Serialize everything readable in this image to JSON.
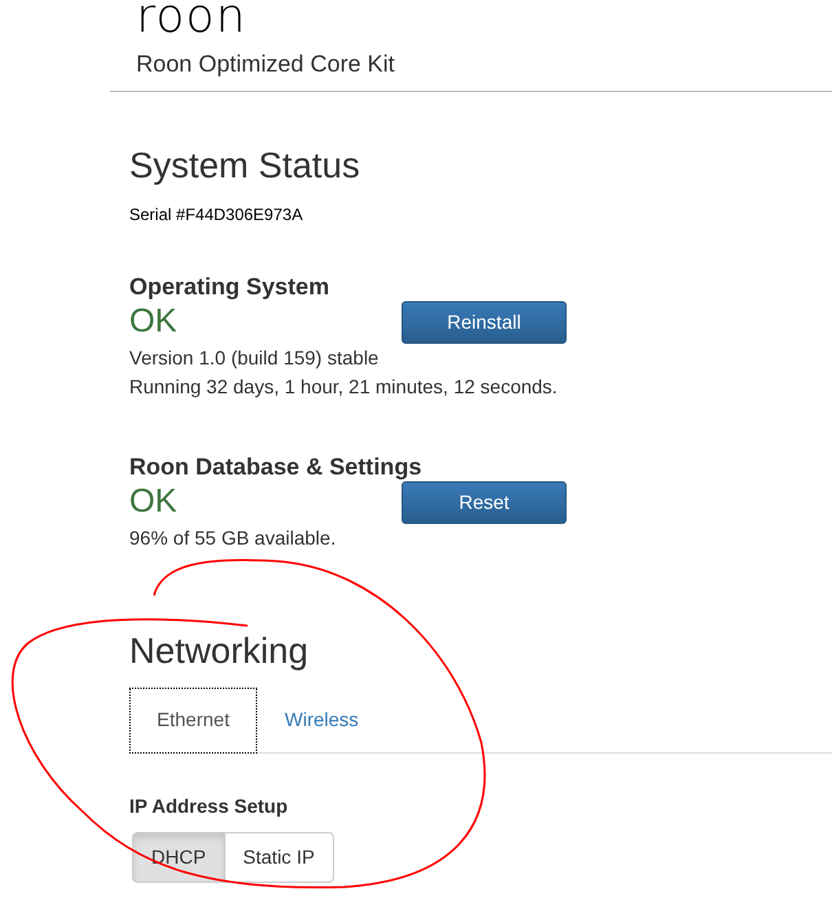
{
  "header": {
    "logo": "roon",
    "subtitle": "Roon Optimized Core Kit"
  },
  "page_title": "System Status",
  "serial": "Serial #F44D306E973A",
  "sections": [
    {
      "title": "Operating System",
      "status": "OK",
      "ok": true,
      "button": "Reinstall",
      "lines": [
        "Version 1.0 (build 159) stable",
        "Running 32 days, 1 hour, 21 minutes, 12 seconds."
      ]
    },
    {
      "title": "Roon Database & Settings",
      "status": "OK",
      "ok": true,
      "button": "Reset",
      "lines": [
        "96% of 55 GB available."
      ]
    }
  ],
  "networking": {
    "title": "Networking",
    "tabs": [
      {
        "label": "Ethernet",
        "selected": true
      },
      {
        "label": "Wireless",
        "selected": false
      }
    ],
    "ip_setup": {
      "label": "IP Address Setup",
      "options": [
        {
          "label": "DHCP",
          "selected": true
        },
        {
          "label": "Static IP",
          "selected": false
        }
      ]
    }
  }
}
